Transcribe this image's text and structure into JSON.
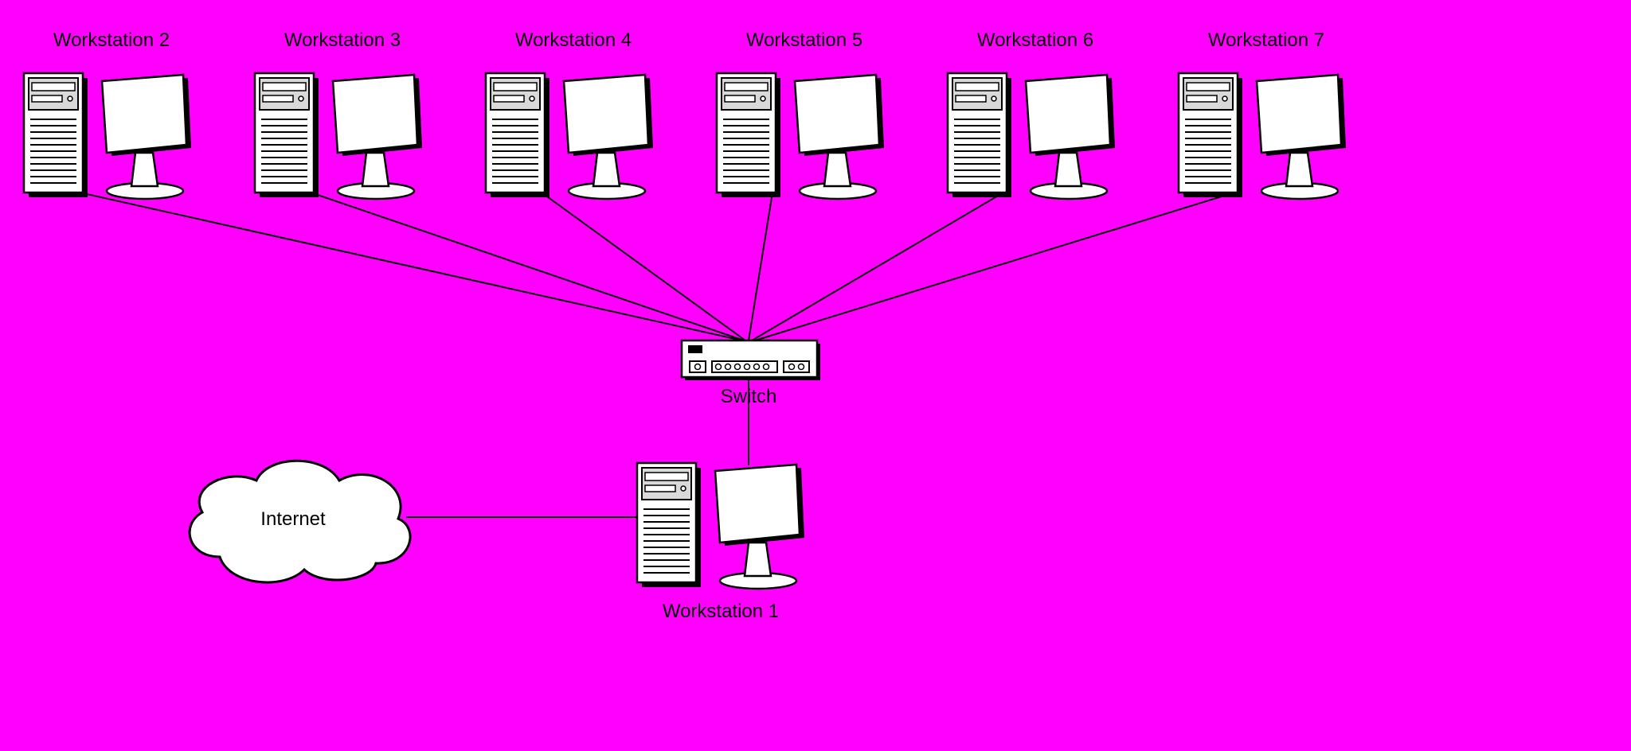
{
  "nodes": {
    "ws1": {
      "label": "Workstation 1"
    },
    "ws2": {
      "label": "Workstation 2"
    },
    "ws3": {
      "label": "Workstation 3"
    },
    "ws4": {
      "label": "Workstation 4"
    },
    "ws5": {
      "label": "Workstation 5"
    },
    "ws6": {
      "label": "Workstation 6"
    },
    "ws7": {
      "label": "Workstation 7"
    },
    "switch": {
      "label": "Switch"
    },
    "internet": {
      "label": "Internet"
    }
  },
  "connections": [
    {
      "from": "ws2",
      "to": "switch"
    },
    {
      "from": "ws3",
      "to": "switch"
    },
    {
      "from": "ws4",
      "to": "switch"
    },
    {
      "from": "ws5",
      "to": "switch"
    },
    {
      "from": "ws6",
      "to": "switch"
    },
    {
      "from": "ws7",
      "to": "switch"
    },
    {
      "from": "switch",
      "to": "ws1"
    },
    {
      "from": "internet",
      "to": "ws1"
    }
  ]
}
